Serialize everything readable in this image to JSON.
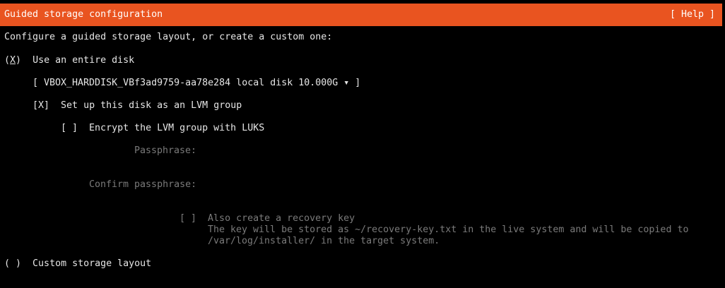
{
  "header": {
    "title": "Guided storage configuration",
    "help_button": "[ Help ]"
  },
  "intro": "Configure a guided storage layout, or create a custom one:",
  "use_entire_disk": {
    "radio_open": "(",
    "radio_mark": "X",
    "radio_close": ")",
    "label": "Use an entire disk",
    "selected": true
  },
  "disk_select": {
    "value": "[ VBOX_HARDDISK_VBf3ad9759-aa78e284 local disk 10.000G ▾ ]"
  },
  "lvm": {
    "checkbox": "[X]",
    "label": "Set up this disk as an LVM group",
    "checked": true
  },
  "luks": {
    "checkbox": "[ ]",
    "label": "Encrypt the LVM group with LUKS",
    "checked": false
  },
  "passphrase": {
    "label": "Passphrase:"
  },
  "confirm_passphrase": {
    "label": "Confirm passphrase:"
  },
  "recovery_key": {
    "checkbox": "[ ]",
    "label": "Also create a recovery key",
    "description_line1": "The key will be stored as ~/recovery-key.txt in the live system and will be copied to",
    "description_line2": "/var/log/installer/ in the target system.",
    "checked": false
  },
  "custom_layout": {
    "radio": "( )",
    "label": "Custom storage layout",
    "selected": false
  },
  "colors": {
    "accent": "#e95420",
    "text": "#e6e6e6",
    "dim_text": "#7a7a7a",
    "background": "#000000"
  }
}
